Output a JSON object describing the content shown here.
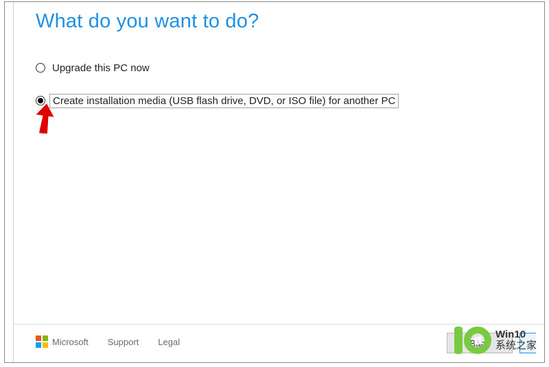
{
  "page": {
    "title": "What do you want to do?"
  },
  "options": {
    "upgrade": {
      "label": "Upgrade this PC now",
      "selected": false
    },
    "create_media": {
      "label": "Create installation media (USB flash drive, DVD, or ISO file) for another PC",
      "selected": true
    }
  },
  "footer": {
    "brand": "Microsoft",
    "support": "Support",
    "legal": "Legal",
    "back": "Back"
  },
  "watermark": {
    "line1": "Win10",
    "line2": "系统之家"
  }
}
